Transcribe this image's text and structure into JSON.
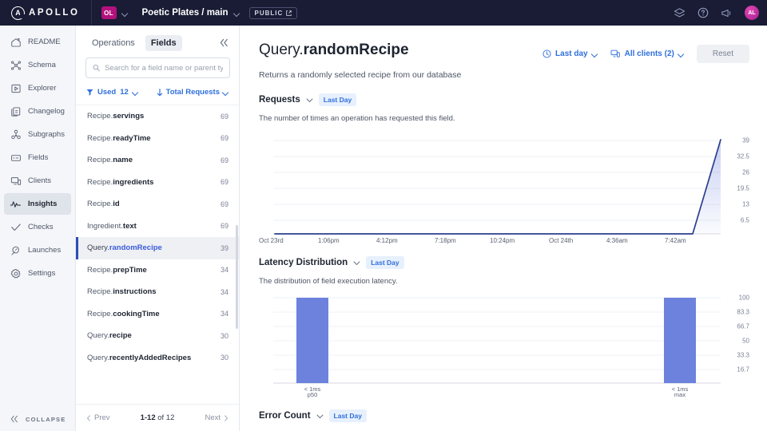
{
  "topbar": {
    "logo_text": "APOLLO",
    "logo_letter": "A",
    "org_badge": "OL",
    "project": "Poetic Plates / main",
    "visibility": "PUBLIC",
    "icons": [
      "stack-icon",
      "help-circle-icon",
      "megaphone-icon"
    ],
    "avatar_initials": "AL"
  },
  "nav": {
    "items": [
      {
        "label": "README",
        "icon": "readme-house-icon",
        "active": false
      },
      {
        "label": "Schema",
        "icon": "schema-graph-icon",
        "active": false
      },
      {
        "label": "Explorer",
        "icon": "explorer-play-icon",
        "active": false
      },
      {
        "label": "Changelog",
        "icon": "changelog-docs-icon",
        "active": false
      },
      {
        "label": "Subgraphs",
        "icon": "subgraphs-nodes-icon",
        "active": false
      },
      {
        "label": "Fields",
        "icon": "fields-box-icon",
        "active": false
      },
      {
        "label": "Clients",
        "icon": "clients-monitor-icon",
        "active": false
      },
      {
        "label": "Insights",
        "icon": "insights-pulse-icon",
        "active": true
      },
      {
        "label": "Checks",
        "icon": "checks-checkmark-icon",
        "active": false
      },
      {
        "label": "Launches",
        "icon": "launches-rocket-icon",
        "active": false
      },
      {
        "label": "Settings",
        "icon": "settings-gear-icon",
        "active": false
      }
    ],
    "collapse_label": "COLLAPSE"
  },
  "panel": {
    "tabs": [
      {
        "label": "Operations",
        "active": false
      },
      {
        "label": "Fields",
        "active": true
      }
    ],
    "search_placeholder": "Search for a field name or parent type",
    "search_value": "",
    "filter_label": "Used",
    "filter_count": "12",
    "sort_label": "Total Requests",
    "fields": [
      {
        "parent": "Recipe.",
        "name": "servings",
        "count": "69",
        "selected": false
      },
      {
        "parent": "Recipe.",
        "name": "readyTime",
        "count": "69",
        "selected": false
      },
      {
        "parent": "Recipe.",
        "name": "name",
        "count": "69",
        "selected": false
      },
      {
        "parent": "Recipe.",
        "name": "ingredients",
        "count": "69",
        "selected": false
      },
      {
        "parent": "Recipe.",
        "name": "id",
        "count": "69",
        "selected": false
      },
      {
        "parent": "Ingredient.",
        "name": "text",
        "count": "69",
        "selected": false
      },
      {
        "parent": "Query.",
        "name": "randomRecipe",
        "count": "39",
        "selected": true
      },
      {
        "parent": "Recipe.",
        "name": "prepTime",
        "count": "34",
        "selected": false
      },
      {
        "parent": "Recipe.",
        "name": "instructions",
        "count": "34",
        "selected": false
      },
      {
        "parent": "Recipe.",
        "name": "cookingTime",
        "count": "34",
        "selected": false
      },
      {
        "parent": "Query.",
        "name": "recipe",
        "count": "30",
        "selected": false
      },
      {
        "parent": "Query.",
        "name": "recentlyAddedRecipes",
        "count": "30",
        "selected": false
      }
    ],
    "prev_label": "Prev",
    "next_label": "Next",
    "page_range": "1-12",
    "page_of": " of 12"
  },
  "main": {
    "title_prefix": "Query.",
    "title_name": "randomRecipe",
    "subtitle": "Returns a randomly selected recipe from our database",
    "time_range": "Last day",
    "clients_filter": "All clients (2)",
    "reset_label": "Reset",
    "sections": [
      {
        "title": "Requests",
        "tag": "Last Day",
        "description": "The number of times an operation has requested this field."
      },
      {
        "title": "Latency Distribution",
        "tag": "Last Day",
        "description": "The distribution of field execution latency."
      },
      {
        "title": "Error Count",
        "tag": "Last Day",
        "description": ""
      }
    ]
  },
  "colors": {
    "topbar_bg": "#191c34",
    "accent_blue": "#2f6fdb",
    "line_stroke": "#2d3f8f",
    "bar_fill": "#6c82dd",
    "selected_row": "#eef0f4",
    "org_badge": "#b3117e"
  },
  "chart_data": [
    {
      "type": "line",
      "title": "Requests",
      "subtitle": "The number of times an operation has requested this field.",
      "xlabel": "",
      "ylabel": "",
      "ylim": [
        0,
        39
      ],
      "yticks": [
        6.5,
        13,
        19.5,
        26,
        32.5,
        39
      ],
      "ytick_labels": [
        "6.5",
        "13",
        "19.5",
        "26",
        "32.5",
        "39"
      ],
      "xtick_labels": [
        "Oct 23rd",
        "1:06pm",
        "4:12pm",
        "7:18pm",
        "10:24pm",
        "Oct 24th",
        "4:36am",
        "7:42am"
      ],
      "grid": true,
      "legend": "none",
      "series": [
        {
          "name": "Requests",
          "x": [
            0,
            0.2,
            0.4,
            0.6,
            0.8,
            0.9,
            0.955,
            1.0
          ],
          "values": [
            0,
            0,
            0,
            0,
            0,
            0,
            0,
            39
          ]
        }
      ],
      "annotation": "Flat at 0 for the full day, sharp spike to 39 at the right edge (after 7:42am)"
    },
    {
      "type": "bar",
      "title": "Latency Distribution",
      "subtitle": "The distribution of field execution latency.",
      "categories": [
        "< 1ms p50",
        "< 1ms max"
      ],
      "category_top": [
        "< 1ms",
        "< 1ms"
      ],
      "category_bottom": [
        "p50",
        "max"
      ],
      "values": [
        100,
        100
      ],
      "xlabel": "",
      "ylabel": "",
      "ylim": [
        0,
        100
      ],
      "yticks": [
        16.7,
        33.3,
        50,
        66.7,
        83.3,
        100
      ],
      "ytick_labels": [
        "16.7",
        "33.3",
        "50",
        "66.7",
        "83.3",
        "100"
      ],
      "grid": true,
      "legend": "none"
    },
    {
      "type": "line",
      "title": "Error Count",
      "subtitle": "",
      "categories": [],
      "values": [],
      "grid": true,
      "legend": "none"
    }
  ]
}
